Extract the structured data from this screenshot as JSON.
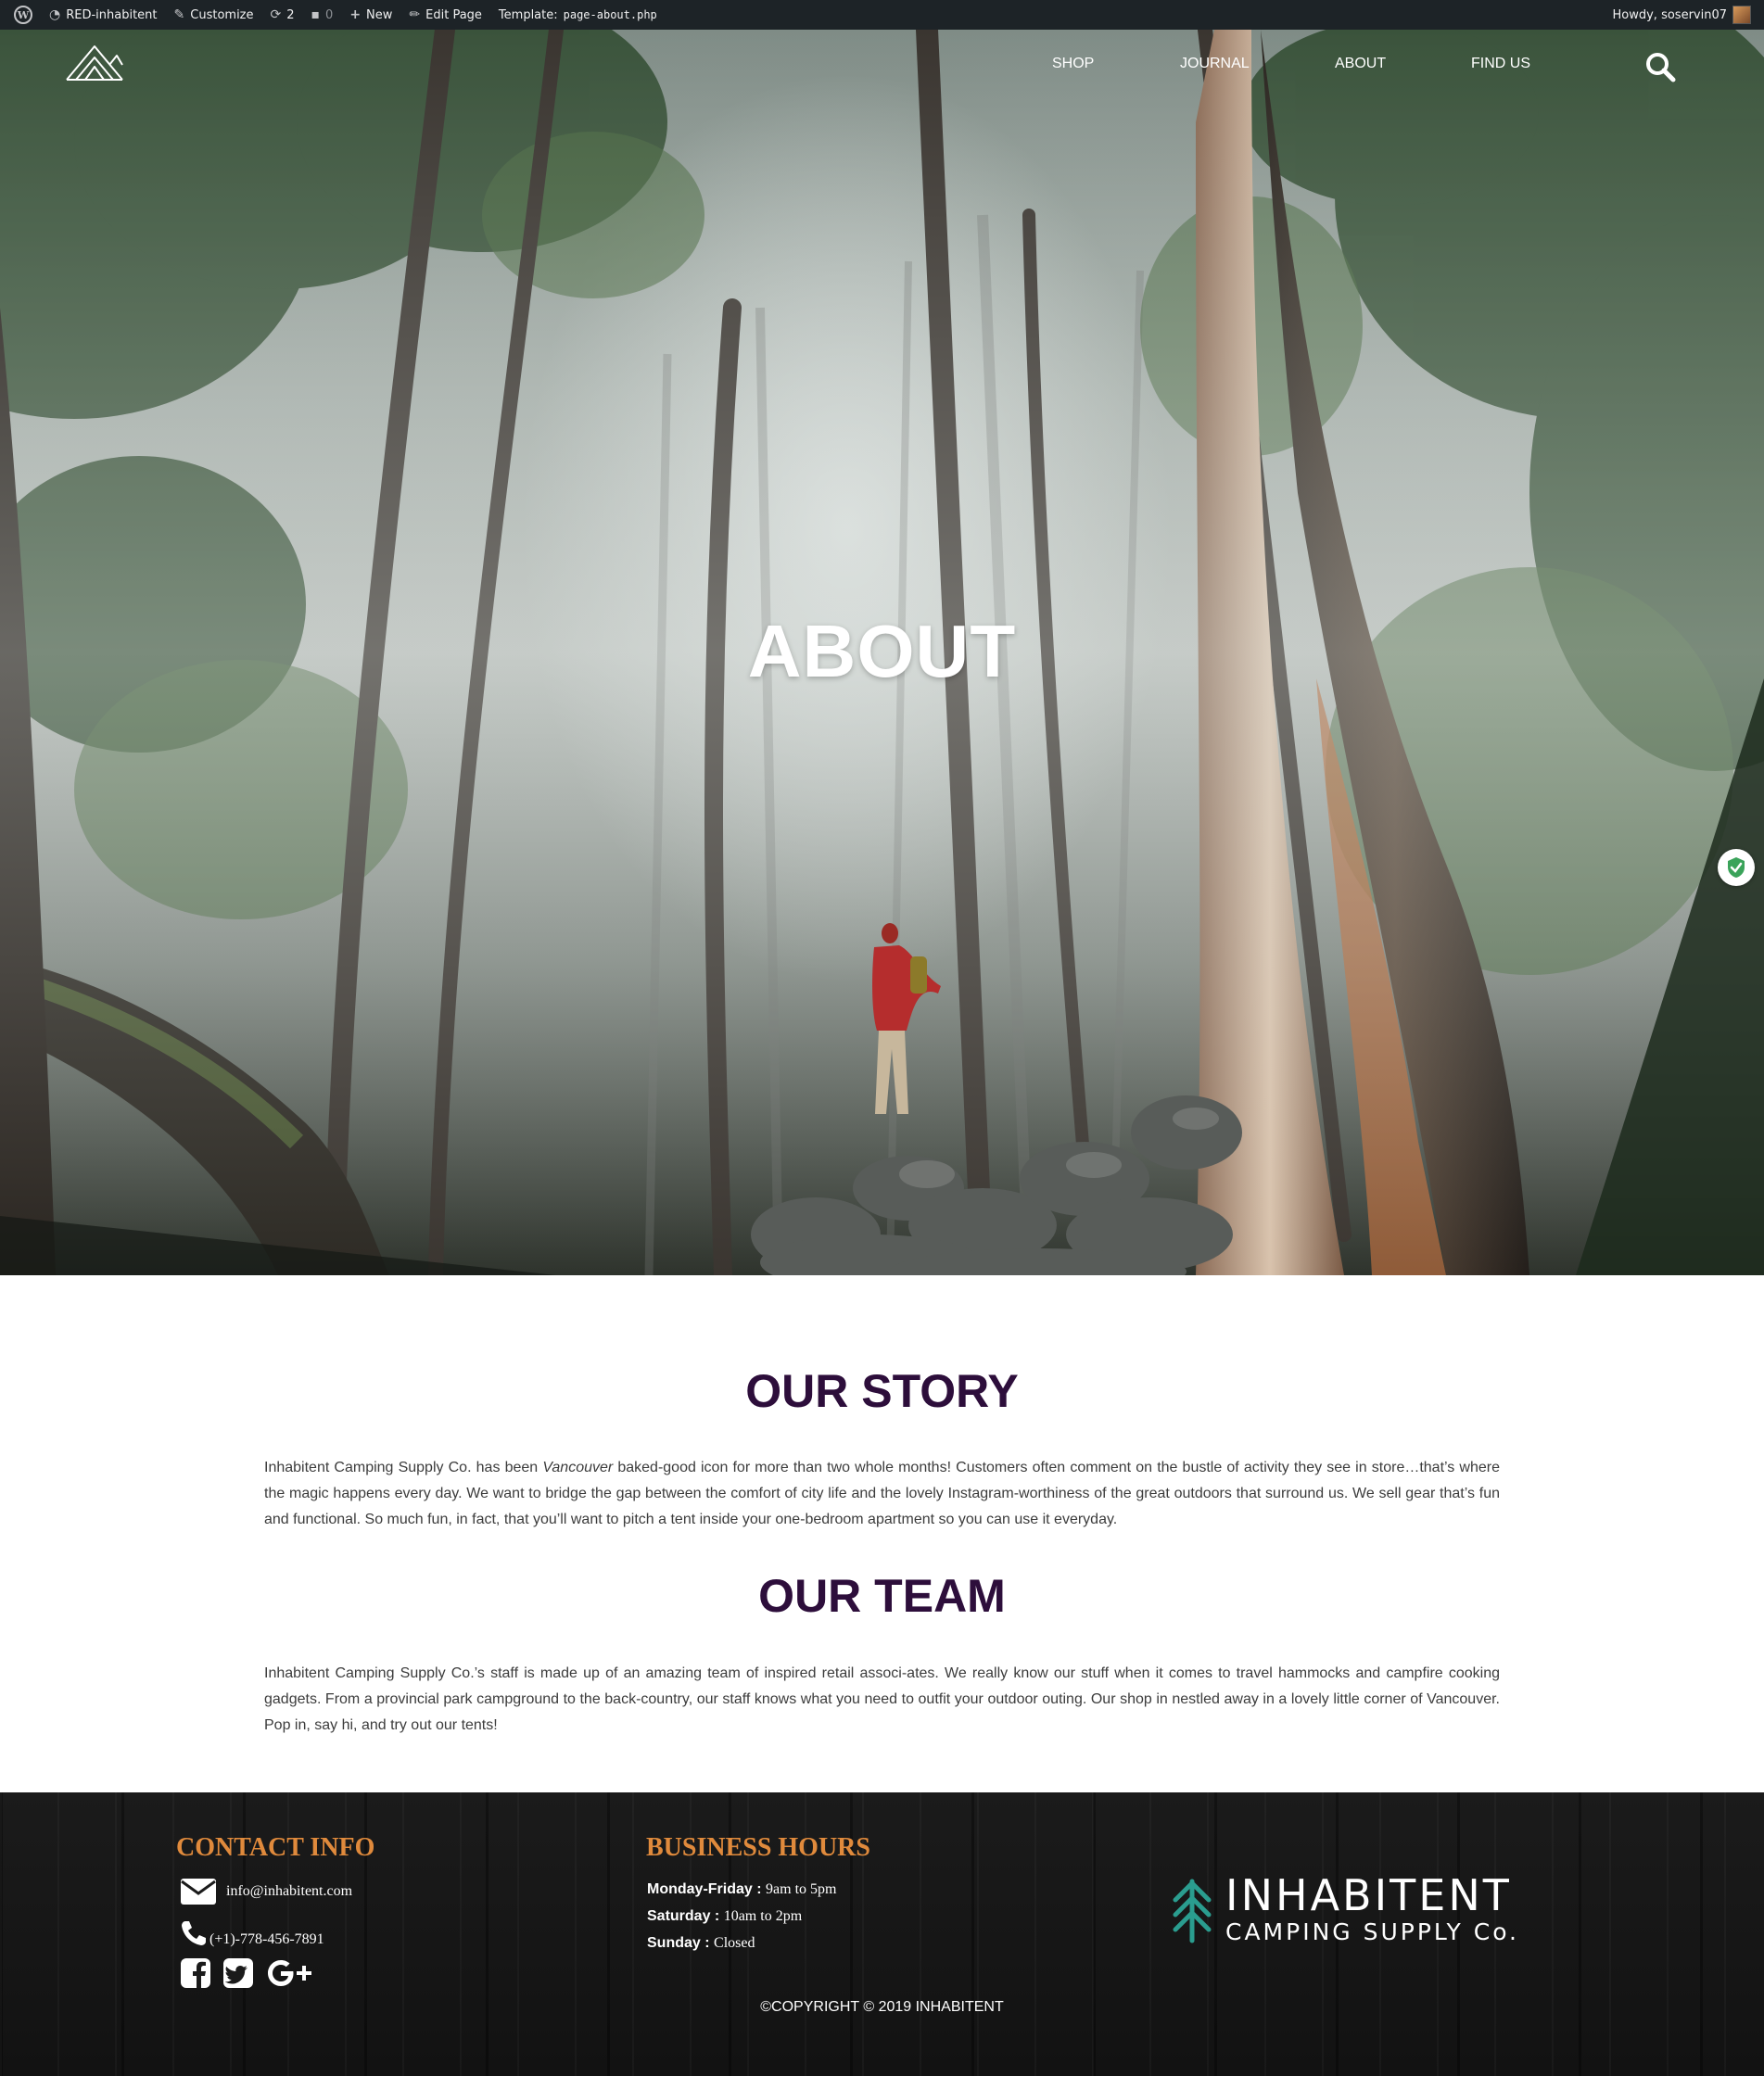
{
  "adminbar": {
    "site_name": "RED-inhabitent",
    "customize": "Customize",
    "updates_count": "2",
    "comments_count": "0",
    "new_label": "New",
    "edit_page": "Edit Page",
    "template_label": "Template:",
    "template_file": "page-about.php",
    "howdy": "Howdy, soservin07"
  },
  "nav": {
    "items": [
      "SHOP",
      "JOURNAL",
      "ABOUT",
      "FIND US"
    ]
  },
  "hero": {
    "title": "ABOUT"
  },
  "story": {
    "title": "OUR STORY",
    "text_before": "Inhabitent Camping Supply Co. has been ",
    "text_italic": "Vancouver",
    "text_after": " baked-good icon for more than two whole months! Customers often comment on the bustle of activity they see in store…that’s where the magic happens every day. We want to bridge the gap between the comfort of city life and the lovely Instagram-worthiness of the great outdoors that surround us. We sell gear that’s fun and functional. So much fun, in fact, that you’ll want to pitch a tent inside your one-bedroom apartment so you can use it everyday."
  },
  "team": {
    "title": "OUR TEAM",
    "text": "Inhabitent Camping Supply Co.’s staff is made up of an amazing team of inspired retail associ-ates. We really know our stuff when it comes to travel hammocks and campfire cooking gadgets. From a provincial park campground to the back-country, our staff knows what you need to outfit your outdoor outing. Our shop in nestled away in a lovely little corner of Vancouver. Pop in, say hi, and try out our tents!"
  },
  "footer": {
    "contact_title": "CONTACT INFO",
    "email": "info@inhabitent.com",
    "phone": "(+1)-778-456-7891",
    "hours_title": "BUSINESS HOURS",
    "hours": [
      {
        "day": "Monday-Friday :",
        "time": "9am to 5pm"
      },
      {
        "day": "Saturday :",
        "time": "10am to 2pm"
      },
      {
        "day": "Sunday :",
        "time": "Closed"
      }
    ],
    "logo_line1": "INHABITENT",
    "logo_line2": "CAMPING SUPPLY Co.",
    "copyright": "©COPYRIGHT © 2019 INHABITENT"
  },
  "colors": {
    "heading_purple": "#2d0e3b",
    "footer_orange": "#e08a3c",
    "logo_teal": "#2a9d8f",
    "adminbar_bg": "#1d2327"
  },
  "icons": [
    "wordpress-icon",
    "dashboard-icon",
    "brush-icon",
    "updates-icon",
    "comments-icon",
    "plus-icon",
    "pencil-icon",
    "search-icon",
    "shield-check-icon",
    "envelope-icon",
    "phone-icon",
    "facebook-icon",
    "twitter-icon",
    "google-plus-icon",
    "tree-icon",
    "tent-logo-icon"
  ]
}
